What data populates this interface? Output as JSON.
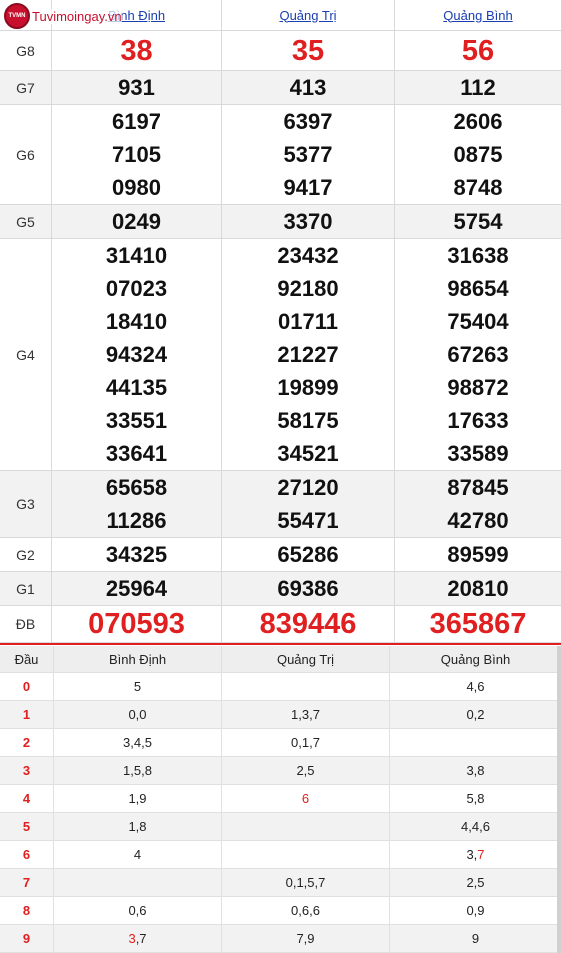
{
  "logo": {
    "text": "Tuvimoingay.vn",
    "badge": "TVMN"
  },
  "provinces": [
    "Bình Định",
    "Quảng Trị",
    "Quảng Bình"
  ],
  "prizes": [
    {
      "label": "G8",
      "values": [
        [
          "38"
        ],
        [
          "35"
        ],
        [
          "56"
        ]
      ]
    },
    {
      "label": "G7",
      "values": [
        [
          "931"
        ],
        [
          "413"
        ],
        [
          "112"
        ]
      ]
    },
    {
      "label": "G6",
      "values": [
        [
          "6197",
          "7105",
          "0980"
        ],
        [
          "6397",
          "5377",
          "9417"
        ],
        [
          "2606",
          "0875",
          "8748"
        ]
      ]
    },
    {
      "label": "G5",
      "values": [
        [
          "0249"
        ],
        [
          "3370"
        ],
        [
          "5754"
        ]
      ]
    },
    {
      "label": "G4",
      "values": [
        [
          "31410",
          "07023",
          "18410",
          "94324",
          "44135",
          "33551",
          "33641"
        ],
        [
          "23432",
          "92180",
          "01711",
          "21227",
          "19899",
          "58175",
          "34521"
        ],
        [
          "31638",
          "98654",
          "75404",
          "67263",
          "98872",
          "17633",
          "33589"
        ]
      ]
    },
    {
      "label": "G3",
      "values": [
        [
          "65658",
          "11286"
        ],
        [
          "27120",
          "55471"
        ],
        [
          "87845",
          "42780"
        ]
      ]
    },
    {
      "label": "G2",
      "values": [
        [
          "34325"
        ],
        [
          "65286"
        ],
        [
          "89599"
        ]
      ]
    },
    {
      "label": "G1",
      "values": [
        [
          "25964"
        ],
        [
          "69386"
        ],
        [
          "20810"
        ]
      ]
    },
    {
      "label": "ĐB",
      "values": [
        [
          "070593"
        ],
        [
          "839446"
        ],
        [
          "365867"
        ]
      ]
    }
  ],
  "loto": {
    "header": [
      "Đầu",
      "Bình Định",
      "Quảng Trị",
      "Quảng Bình"
    ],
    "rows": [
      {
        "d": "0",
        "c": [
          [
            [
              "5",
              ""
            ]
          ],
          [],
          [
            [
              "4,6",
              ""
            ]
          ]
        ]
      },
      {
        "d": "1",
        "c": [
          [
            [
              "0,0",
              ""
            ]
          ],
          [
            [
              "1,3,7",
              ""
            ]
          ],
          [
            [
              "0,2",
              ""
            ]
          ]
        ]
      },
      {
        "d": "2",
        "c": [
          [
            [
              "3,4,5",
              ""
            ]
          ],
          [
            [
              "0,1,7",
              ""
            ]
          ],
          []
        ]
      },
      {
        "d": "3",
        "c": [
          [
            [
              "1,5,8",
              ""
            ]
          ],
          [
            [
              "2,5",
              ""
            ]
          ],
          [
            [
              "3,8",
              ""
            ]
          ]
        ]
      },
      {
        "d": "4",
        "c": [
          [
            [
              "1,9",
              ""
            ]
          ],
          [
            [
              "6",
              "r"
            ]
          ],
          [
            [
              "5,8",
              ""
            ]
          ]
        ]
      },
      {
        "d": "5",
        "c": [
          [
            [
              "1,8",
              ""
            ]
          ],
          [],
          [
            [
              "4,4,6",
              ""
            ]
          ]
        ]
      },
      {
        "d": "6",
        "c": [
          [
            [
              "4",
              ""
            ]
          ],
          [],
          [
            [
              "3,",
              ""
            ],
            [
              "7",
              "r"
            ]
          ]
        ]
      },
      {
        "d": "7",
        "c": [
          [],
          [
            [
              "0,1,5,7",
              ""
            ]
          ],
          [
            [
              "2,5",
              ""
            ]
          ]
        ]
      },
      {
        "d": "8",
        "c": [
          [
            [
              "0,6",
              ""
            ]
          ],
          [
            [
              "0,6,6",
              ""
            ]
          ],
          [
            [
              "0,9",
              ""
            ]
          ]
        ]
      },
      {
        "d": "9",
        "c": [
          [
            [
              "3",
              "r"
            ],
            [
              ",7",
              ""
            ]
          ],
          [
            [
              "7,9",
              ""
            ]
          ],
          [
            [
              "9",
              ""
            ]
          ]
        ]
      }
    ]
  },
  "colors": {
    "prize_red": "#e02020",
    "link_blue": "#1a3fb0",
    "logo_red": "#c8102e"
  }
}
